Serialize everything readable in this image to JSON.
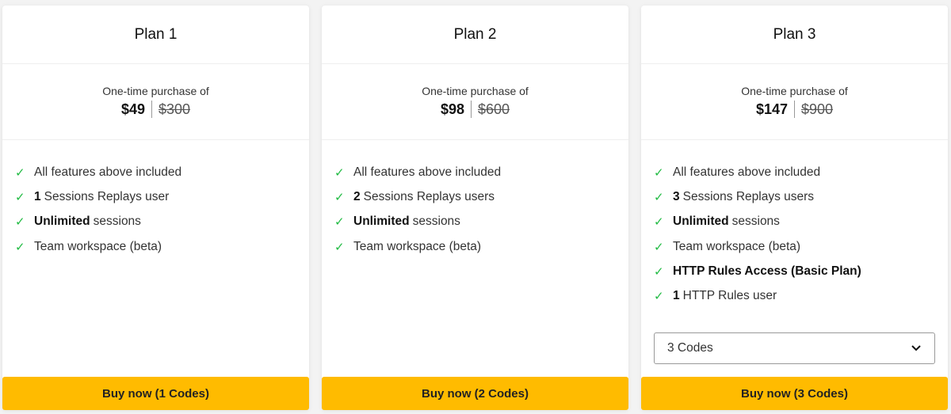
{
  "colors": {
    "accent": "#ffbb00",
    "check": "#22bb44"
  },
  "plans": [
    {
      "title": "Plan 1",
      "price_label": "One-time purchase of",
      "price": "$49",
      "original_price": "$300",
      "features": [
        {
          "bold": "",
          "text": "All features above included"
        },
        {
          "bold": "1",
          "text": "Sessions Replays user"
        },
        {
          "bold": "Unlimited",
          "text": "sessions"
        },
        {
          "bold": "",
          "text": "Team workspace (beta)"
        }
      ],
      "button": "Buy now (1 Codes)"
    },
    {
      "title": "Plan 2",
      "price_label": "One-time purchase of",
      "price": "$98",
      "original_price": "$600",
      "features": [
        {
          "bold": "",
          "text": "All features above included"
        },
        {
          "bold": "2",
          "text": "Sessions Replays users"
        },
        {
          "bold": "Unlimited",
          "text": "sessions"
        },
        {
          "bold": "",
          "text": "Team workspace (beta)"
        }
      ],
      "button": "Buy now (2 Codes)"
    },
    {
      "title": "Plan 3",
      "price_label": "One-time purchase of",
      "price": "$147",
      "original_price": "$900",
      "features": [
        {
          "bold": "",
          "text": "All features above included"
        },
        {
          "bold": "3",
          "text": "Sessions Replays users"
        },
        {
          "bold": "Unlimited",
          "text": "sessions"
        },
        {
          "bold": "",
          "text": "Team workspace (beta)"
        },
        {
          "bold": "HTTP Rules Access (Basic Plan)",
          "text": ""
        },
        {
          "bold": "1",
          "text": "HTTP Rules user"
        }
      ],
      "select": {
        "value": "3 Codes",
        "icon": "chevron-down-icon"
      },
      "button": "Buy now (3 Codes)"
    }
  ]
}
